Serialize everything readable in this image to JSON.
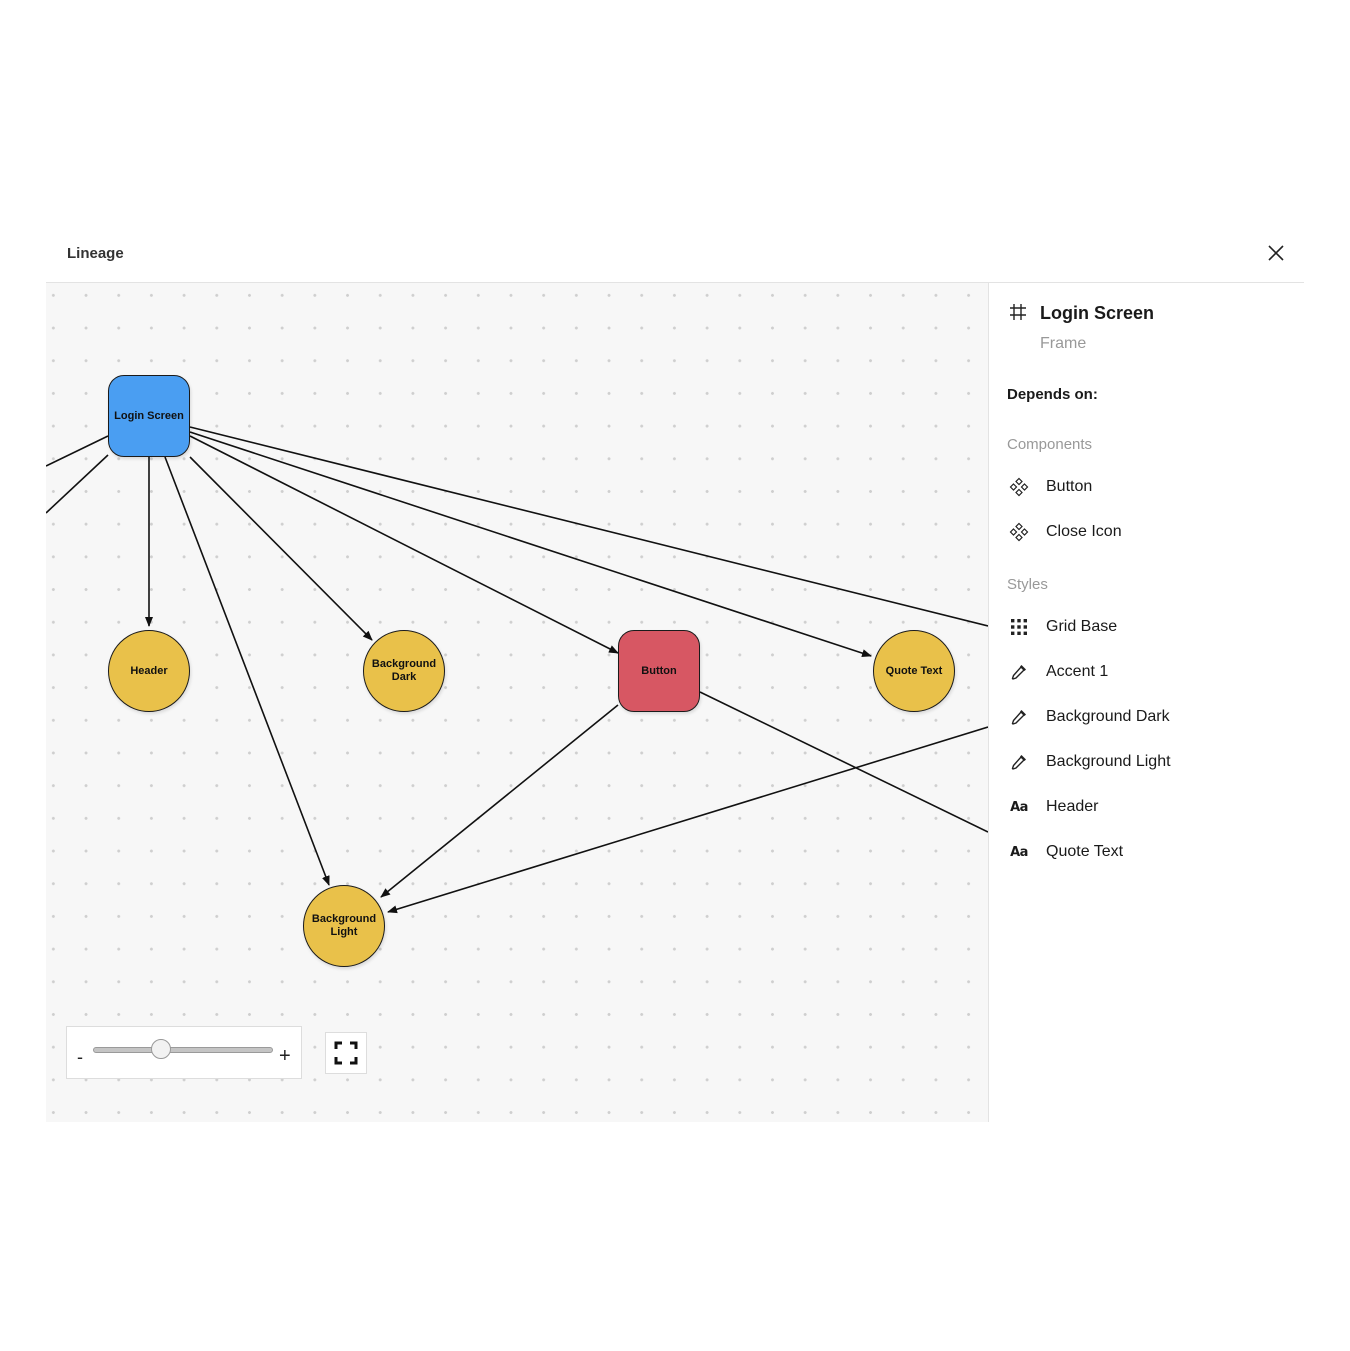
{
  "dialog": {
    "title": "Lineage",
    "close_icon": "close-icon"
  },
  "graph": {
    "nodes": [
      {
        "id": "login-screen",
        "label": "Login Screen",
        "shape": "rect",
        "color": "#4a9ef2"
      },
      {
        "id": "header",
        "label": "Header",
        "shape": "circle",
        "color": "#e9c14a"
      },
      {
        "id": "background-dark",
        "label": "Background Dark",
        "shape": "circle",
        "color": "#e9c14a"
      },
      {
        "id": "button",
        "label": "Button",
        "shape": "rect",
        "color": "#d75763"
      },
      {
        "id": "quote-text",
        "label": "Quote Text",
        "shape": "circle",
        "color": "#e9c14a"
      },
      {
        "id": "background-light",
        "label": "Background Light",
        "shape": "circle",
        "color": "#e9c14a"
      }
    ],
    "edges": [
      {
        "from": "login-screen",
        "to": "header"
      },
      {
        "from": "login-screen",
        "to": "background-dark"
      },
      {
        "from": "login-screen",
        "to": "button"
      },
      {
        "from": "login-screen",
        "to": "quote-text"
      },
      {
        "from": "login-screen",
        "to": "background-light"
      },
      {
        "from": "login-screen",
        "to": "offscreen-right"
      },
      {
        "from": "offscreen-left",
        "to": "login-screen"
      },
      {
        "from": "offscreen-left-2",
        "to": "login-screen"
      },
      {
        "from": "button",
        "to": "background-light"
      },
      {
        "from": "button",
        "to": "offscreen-right"
      },
      {
        "from": "offscreen-right",
        "to": "background-light"
      }
    ]
  },
  "zoom_control": {
    "minus_label": "-",
    "plus_label": "+",
    "level": 0.38,
    "fit_icon": "fit-screen-icon"
  },
  "panel": {
    "icon": "frame-icon",
    "title": "Login Screen",
    "subtitle": "Frame",
    "depends_label": "Depends on:",
    "sections": [
      {
        "label": "Components",
        "items": [
          {
            "label": "Button",
            "icon": "component-icon"
          },
          {
            "label": "Close Icon",
            "icon": "component-icon"
          }
        ]
      },
      {
        "label": "Styles",
        "items": [
          {
            "label": "Grid Base",
            "icon": "grid-icon"
          },
          {
            "label": "Accent 1",
            "icon": "eyedropper-icon"
          },
          {
            "label": "Background Dark",
            "icon": "eyedropper-icon"
          },
          {
            "label": "Background Light",
            "icon": "eyedropper-icon"
          },
          {
            "label": "Header",
            "icon": "text-style-icon",
            "glyph": "Aa"
          },
          {
            "label": "Quote Text",
            "icon": "text-style-icon",
            "glyph": "Aa"
          }
        ]
      }
    ]
  }
}
